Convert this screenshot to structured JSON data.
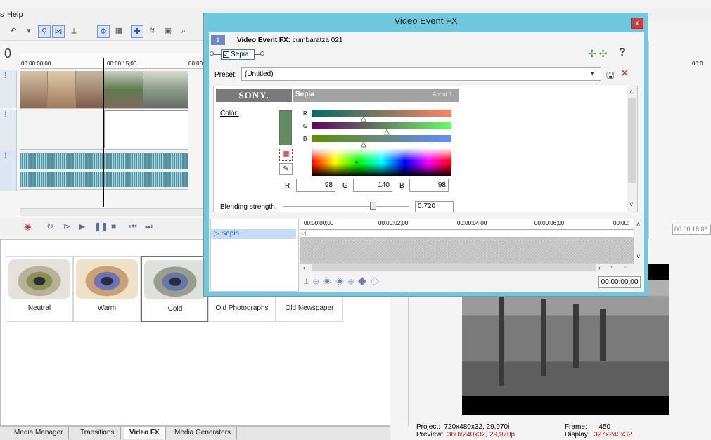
{
  "app": {
    "menu": {
      "help": "Help",
      "partial_left": "s"
    },
    "timeline": {
      "counter": "0",
      "ruler": [
        "00:00:00;00",
        "00:00:15;00",
        "00:00"
      ],
      "right_ruler": "00:0"
    },
    "right_panel": {
      "time": "00:00:16;06"
    }
  },
  "dialog": {
    "title": "Video Event FX",
    "close_label": "x",
    "event_badge": "1",
    "event_title_bold": "Video Event FX:",
    "event_name": "cumbaratza 021",
    "chain_checkbox": "✓",
    "chain_plugin": "Sepia",
    "help": "?",
    "preset_label": "Preset:",
    "preset_value": "(Untitled)",
    "plugin": {
      "brand": "SONY.",
      "name": "Sepia",
      "about": "About  ?"
    },
    "color": {
      "label": "Color:",
      "swatch": "#628c62",
      "channels": {
        "r_label": "R",
        "g_label": "G",
        "b_label": "B"
      },
      "values": {
        "r": "98",
        "g": "140",
        "b": "98"
      }
    },
    "blending": {
      "label": "Blending strength:",
      "value": "0.720"
    },
    "keyframes": {
      "track": "Sepia",
      "ruler": [
        "00:00:00;00",
        "00:00:02;00",
        "00:00:04;00",
        "00:00:06;00",
        "00:00:"
      ],
      "time": "00:00:00;00"
    }
  },
  "presets": [
    {
      "label": "Neutral"
    },
    {
      "label": "Warm"
    },
    {
      "label": "Cold"
    },
    {
      "label": "Old Photographs"
    },
    {
      "label": "Old Newspaper"
    }
  ],
  "tabs": [
    "Media Manager",
    "Transitions",
    "Video FX",
    "Media Generators"
  ],
  "preview": {
    "project_label": "Project:",
    "project_value": "720x480x32, 29,970i",
    "preview_label": "Preview:",
    "preview_value": "360x240x32, 29,970p",
    "frame_label": "Frame:",
    "frame_value": "450",
    "display_label": "Display:",
    "display_value": "327x240x32"
  }
}
